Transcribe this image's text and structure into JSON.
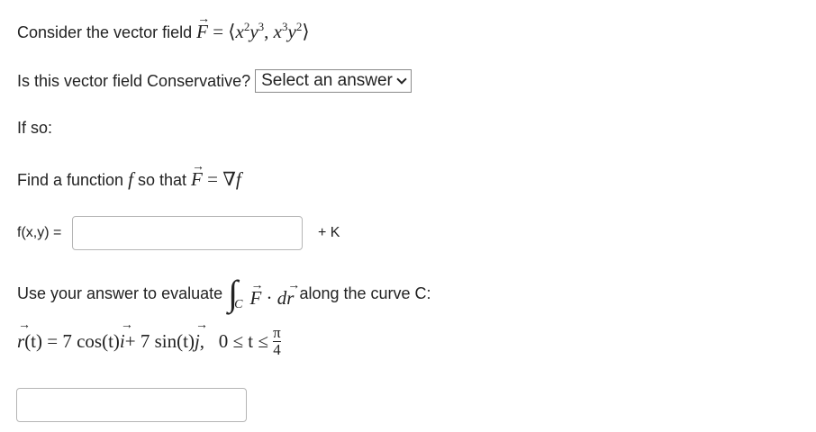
{
  "q1": {
    "prefix": "Consider the vector field",
    "F": "F",
    "eq": " = ",
    "open": "⟨",
    "comp1_a": "x",
    "comp1_a_exp": "2",
    "comp1_b": "y",
    "comp1_b_exp": "3",
    "comma": ", ",
    "comp2_a": "x",
    "comp2_a_exp": "3",
    "comp2_b": "y",
    "comp2_b_exp": "2",
    "close": "⟩"
  },
  "q2": {
    "text": "Is this vector field Conservative?",
    "select_value": "Select an answer"
  },
  "if_so": "If so:",
  "q3": {
    "prefix": "Find a function",
    "f": "f",
    "mid": "so that",
    "F": "F",
    "eq": " = ",
    "nabla": "∇",
    "f2": "f"
  },
  "q4": {
    "label": "f(x,y) =",
    "input_value": "",
    "suffix": "+ K"
  },
  "q5": {
    "prefix": "Use your answer to evaluate",
    "integral": "∫",
    "sub": "C",
    "F": "F",
    "dot": " · ",
    "d": "d",
    "r": "r",
    "suffix": "along the curve C:"
  },
  "curve": {
    "r": "r",
    "lhs": "(t) = 7 cos(t)",
    "i": "i",
    "mid": " + 7 sin(t)",
    "j": "j",
    "range": ",   0 ≤ t ≤ ",
    "num": "π",
    "den": "4"
  },
  "answer": {
    "input_value": ""
  }
}
